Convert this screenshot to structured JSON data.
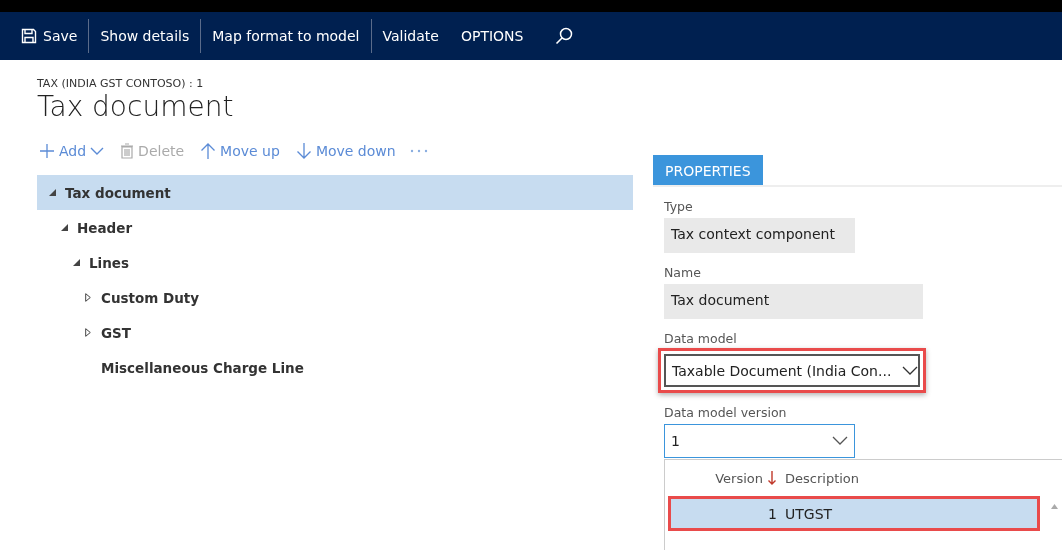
{
  "toolbar": {
    "buttons": [
      {
        "label": "Save",
        "kind": "save"
      },
      {
        "label": "Show details",
        "kind": "plain"
      },
      {
        "label": "Map format to model",
        "kind": "plain"
      },
      {
        "label": "Validate",
        "kind": "plain"
      },
      {
        "label": "OPTIONS",
        "kind": "plain"
      }
    ]
  },
  "breadcrumb": "TAX (INDIA GST CONTOSO) : 1",
  "title": "Tax document",
  "actions": [
    {
      "label": "Add",
      "kind": "add",
      "disabled": false
    },
    {
      "label": "Delete",
      "kind": "delete",
      "disabled": true
    },
    {
      "label": "Move up",
      "kind": "up",
      "disabled": false
    },
    {
      "label": "Move down",
      "kind": "down",
      "disabled": false
    }
  ],
  "tree": [
    {
      "label": "Tax document",
      "selected": true,
      "expanded": true,
      "children": [
        {
          "label": "Header",
          "selected": false,
          "expanded": true,
          "children": [
            {
              "label": "Lines",
              "selected": false,
              "expanded": true,
              "children": [
                {
                  "label": "Custom Duty",
                  "selected": false,
                  "expanded": false
                },
                {
                  "label": "GST",
                  "selected": false,
                  "expanded": false
                },
                {
                  "label": "Miscellaneous Charge Line",
                  "selected": false
                }
              ]
            }
          ]
        }
      ]
    }
  ],
  "properties": {
    "tab": "PROPERTIES",
    "fields": [
      {
        "label": "Type",
        "value": "Tax context component",
        "kind": "readonly",
        "highlighted": false
      },
      {
        "label": "Name",
        "value": "Tax document",
        "kind": "readonly",
        "highlighted": false
      },
      {
        "label": "Data model",
        "value": "Taxable Document (India Con...",
        "kind": "select",
        "highlighted": true
      },
      {
        "label": "Data model version",
        "value": "1",
        "kind": "lookup",
        "highlighted": false
      }
    ],
    "lookup": {
      "columns": [
        "Version",
        "Description"
      ],
      "rows": [
        {
          "version": "1",
          "description": "UTGST",
          "selected": true,
          "highlighted": true
        }
      ]
    }
  }
}
